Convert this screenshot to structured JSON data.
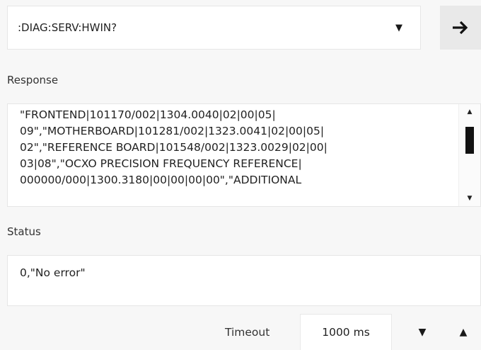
{
  "command": {
    "value": ":DIAG:SERV:HWIN?",
    "dropdown_icon": "▼",
    "send_icon": "arrow-right-icon"
  },
  "response": {
    "label": "Response",
    "text": "\"FRONTEND|101170/002|1304.0040|02|00|05|\n09\",\"MOTHERBOARD|101281/002|1323.0041|02|00|05|\n02\",\"REFERENCE BOARD|101548/002|1323.0029|02|00|\n03|08\",\"OCXO PRECISION FREQUENCY REFERENCE|\n000000/000|1300.3180|00|00|00|00\",\"ADDITIONAL",
    "scroll_up_icon": "▲",
    "scroll_down_icon": "▼"
  },
  "status": {
    "label": "Status",
    "text": "0,\"No error\""
  },
  "timeout": {
    "label": "Timeout",
    "value": "1000 ms",
    "down_icon": "▼",
    "up_icon": "▲"
  }
}
